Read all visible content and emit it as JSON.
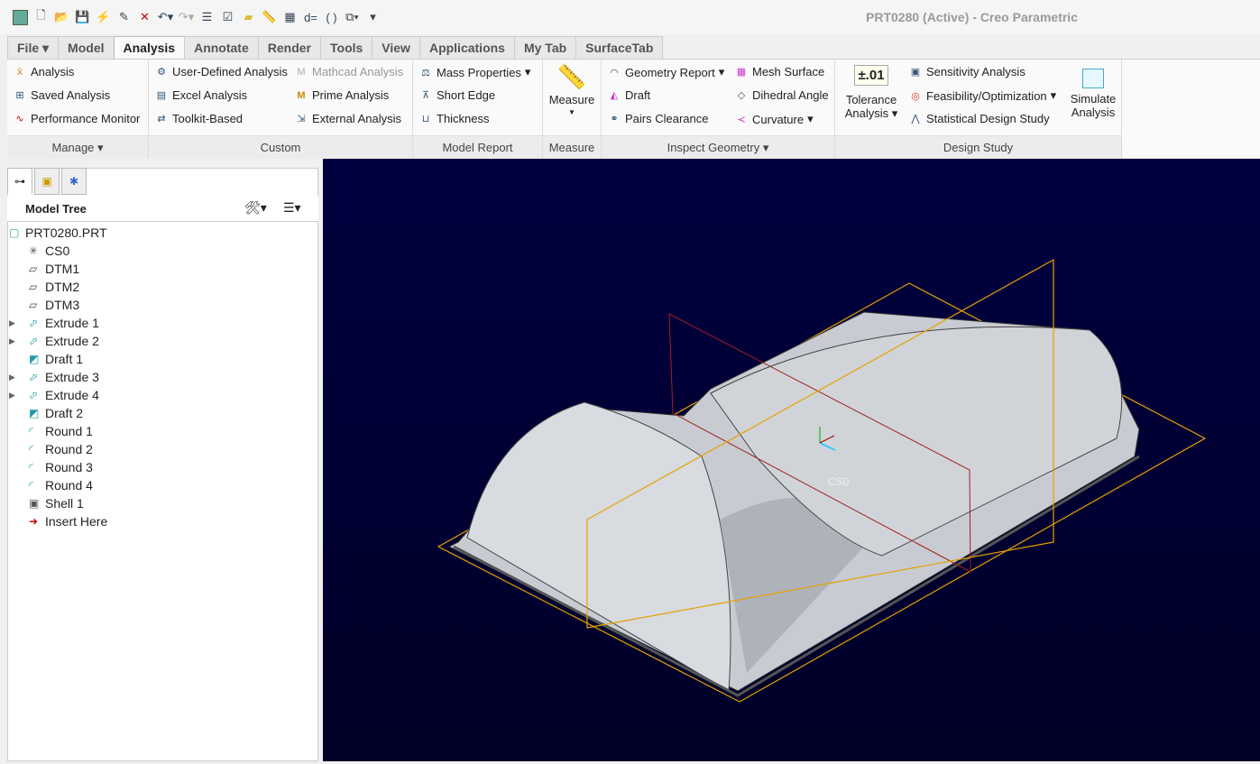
{
  "window": {
    "title": "PRT0280 (Active) - Creo Parametric"
  },
  "quick_access": [
    "app-icon",
    "new-icon",
    "open-icon",
    "save-icon",
    "regenerate-icon",
    "edit-icon",
    "close-window-icon",
    "undo-icon",
    "redo-icon",
    "relations-icon",
    "select-icon",
    "folder-icon",
    "measure-icon",
    "parameters-icon",
    "d-equals-icon",
    "brackets-icon",
    "windows-icon",
    "customize-icon"
  ],
  "tabs": [
    "File",
    "Model",
    "Analysis",
    "Annotate",
    "Render",
    "Tools",
    "View",
    "Applications",
    "My Tab",
    "SurfaceTab"
  ],
  "active_tab": "Analysis",
  "groups": {
    "manage": {
      "label": "Manage",
      "items": [
        "Analysis",
        "Saved Analysis",
        "Performance Monitor"
      ]
    },
    "custom": {
      "label": "Custom",
      "items": [
        "User-Defined Analysis",
        "Excel Analysis",
        "Toolkit-Based",
        "Mathcad Analysis",
        "Prime Analysis",
        "External Analysis"
      ]
    },
    "model_report": {
      "label": "Model Report",
      "items": [
        "Mass Properties",
        "Short Edge",
        "Thickness"
      ]
    },
    "measure": {
      "label": "Measure",
      "button": "Measure"
    },
    "inspect": {
      "label": "Inspect Geometry",
      "items": [
        "Geometry Report",
        "Draft",
        "Pairs Clearance",
        "Mesh Surface",
        "Dihedral Angle",
        "Curvature"
      ]
    },
    "design": {
      "label": "Design Study",
      "tolerance_line1": "Tolerance",
      "tolerance_line2": "Analysis",
      "tolerance_icon": "±.01",
      "items": [
        "Sensitivity Analysis",
        "Feasibility/Optimization",
        "Statistical Design Study"
      ],
      "simulate_line1": "Simulate",
      "simulate_line2": "Analysis"
    }
  },
  "tree": {
    "title": "Model Tree",
    "items": [
      {
        "label": "PRT0280.PRT",
        "icon": "part-icon",
        "expand": false,
        "indent": 0
      },
      {
        "label": "CS0",
        "icon": "csys-icon",
        "expand": false,
        "indent": 1
      },
      {
        "label": "DTM1",
        "icon": "datum-plane-icon",
        "expand": false,
        "indent": 1
      },
      {
        "label": "DTM2",
        "icon": "datum-plane-icon",
        "expand": false,
        "indent": 1
      },
      {
        "label": "DTM3",
        "icon": "datum-plane-icon",
        "expand": false,
        "indent": 1
      },
      {
        "label": "Extrude 1",
        "icon": "extrude-icon",
        "expand": true,
        "indent": 1
      },
      {
        "label": "Extrude 2",
        "icon": "extrude-icon",
        "expand": true,
        "indent": 1
      },
      {
        "label": "Draft 1",
        "icon": "draft-icon",
        "expand": false,
        "indent": 1
      },
      {
        "label": "Extrude 3",
        "icon": "extrude-icon",
        "expand": true,
        "indent": 1
      },
      {
        "label": "Extrude 4",
        "icon": "extrude-icon",
        "expand": true,
        "indent": 1
      },
      {
        "label": "Draft 2",
        "icon": "draft-icon",
        "expand": false,
        "indent": 1
      },
      {
        "label": "Round 1",
        "icon": "round-icon",
        "expand": false,
        "indent": 1
      },
      {
        "label": "Round 2",
        "icon": "round-icon",
        "expand": false,
        "indent": 1
      },
      {
        "label": "Round 3",
        "icon": "round-icon",
        "expand": false,
        "indent": 1
      },
      {
        "label": "Round 4",
        "icon": "round-icon",
        "expand": false,
        "indent": 1
      },
      {
        "label": "Shell 1",
        "icon": "shell-icon",
        "expand": false,
        "indent": 1
      },
      {
        "label": "Insert Here",
        "icon": "insert-arrow-icon",
        "expand": false,
        "indent": 1
      }
    ]
  },
  "viewport": {
    "csys_label": "CS0",
    "background": "#000038",
    "datum_color": "#e8a000"
  }
}
